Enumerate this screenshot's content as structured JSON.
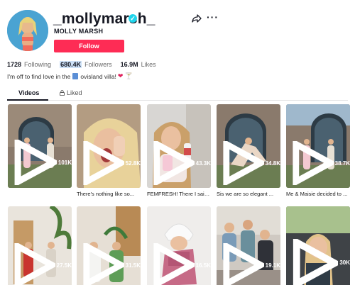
{
  "profile": {
    "username": "_mollymarsh_",
    "nickname": "MOLLY MARSH",
    "follow_label": "Follow",
    "bio_part1": "I'm off to find love in the",
    "bio_part2": "ovisland villa!"
  },
  "stats": [
    {
      "value": "1728",
      "label": "Following"
    },
    {
      "value": "680.4K",
      "label": "Followers"
    },
    {
      "value": "16.9M",
      "label": "Likes"
    }
  ],
  "tabs": {
    "videos": "Videos",
    "liked": "Liked"
  },
  "videos": [
    {
      "views": "101K",
      "caption": ""
    },
    {
      "views": "52.8K",
      "caption": "There's nothing like so..."
    },
    {
      "views": "43.3K",
      "caption": "FEMFRESH! There I said..."
    },
    {
      "views": "34.8K",
      "caption": "Sis we are so elegant ..."
    },
    {
      "views": "38.7K",
      "caption": "Me & Maisie decided to ..."
    },
    {
      "views": "27.5K",
      "caption": ""
    },
    {
      "views": "31.5K",
      "caption": ""
    },
    {
      "views": "16.5K",
      "caption": ""
    },
    {
      "views": "19.1K",
      "caption": ""
    },
    {
      "views": "30K",
      "caption": ""
    }
  ],
  "colors": {
    "accent": "#fe2c55",
    "verified": "#20d5ec",
    "highlight": "#cde1f7"
  },
  "icons": [
    "verified-icon",
    "share-icon",
    "more-icon",
    "lock-icon",
    "play-icon"
  ]
}
